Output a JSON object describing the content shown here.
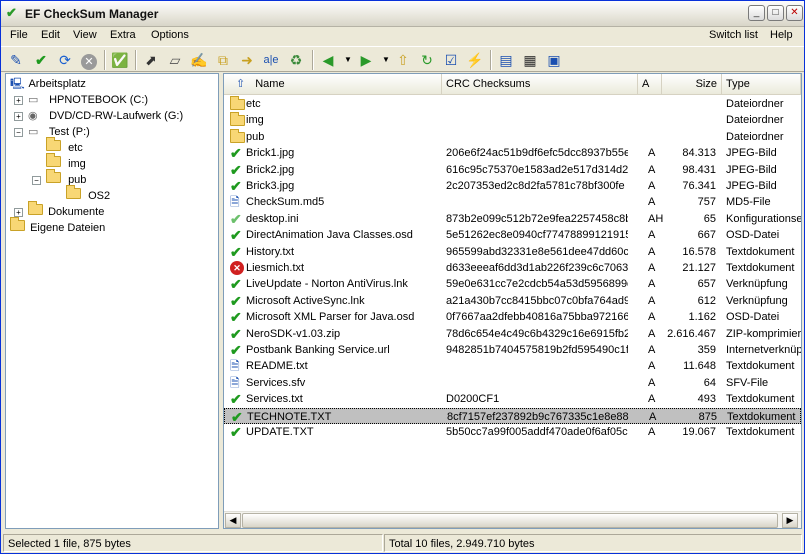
{
  "window": {
    "title": "EF CheckSum Manager",
    "min": "_",
    "max": "□",
    "close": "✕"
  },
  "menu": {
    "left": [
      "File",
      "Edit",
      "View",
      "Extra",
      "Options"
    ],
    "switch_list": "Switch list",
    "help": "Help"
  },
  "toolbar": {
    "icons": [
      "new-checksum-icon",
      "check-icon",
      "refresh-icon",
      "stop-icon",
      "verify-icon",
      "new-file-icon",
      "open-icon",
      "edit-icon",
      "copy-icon",
      "move-icon",
      "rename-icon",
      "properties-icon",
      "back-icon",
      "forward-icon",
      "up-folder-icon",
      "refresh-folder-icon",
      "check-list-icon",
      "flash-icon",
      "view-list-icon",
      "view-details-icon",
      "view-thumbs-icon"
    ]
  },
  "tree": {
    "root": "Arbeitsplatz",
    "items": [
      {
        "label": "HPNOTEBOOK (C:)",
        "type": "drive"
      },
      {
        "label": "DVD/CD-RW-Laufwerk (G:)",
        "type": "cdrom"
      },
      {
        "label": "Test (P:)",
        "type": "drive"
      },
      {
        "label": "etc",
        "type": "folder"
      },
      {
        "label": "img",
        "type": "folder"
      },
      {
        "label": "pub",
        "type": "folder"
      },
      {
        "label": "OS2",
        "type": "folder"
      },
      {
        "label": "Dokumente",
        "type": "folder"
      },
      {
        "label": "Eigene Dateien",
        "type": "docs"
      }
    ]
  },
  "list": {
    "headers": {
      "name": "Name",
      "crc": "CRC Checksums",
      "a": "A",
      "size": "Size",
      "type": "Type"
    },
    "rows": [
      {
        "status": "folder",
        "name": "etc",
        "crc": "",
        "a": "",
        "size": "",
        "type": "Dateiordner"
      },
      {
        "status": "folder",
        "name": "img",
        "crc": "",
        "a": "",
        "size": "",
        "type": "Dateiordner"
      },
      {
        "status": "folder",
        "name": "pub",
        "crc": "",
        "a": "",
        "size": "",
        "type": "Dateiordner"
      },
      {
        "status": "ok",
        "name": "Brick1.jpg",
        "crc": "206e6f24ac51b9df6efc5dcc8937b55e",
        "a": "A",
        "size": "84.313",
        "type": "JPEG-Bild"
      },
      {
        "status": "ok",
        "name": "Brick2.jpg",
        "crc": "616c95c75370e1583ad2e517d314d2b",
        "a": "A",
        "size": "98.431",
        "type": "JPEG-Bild"
      },
      {
        "status": "ok",
        "name": "Brick3.jpg",
        "crc": "2c207353ed2c8d2fa5781c78bf300fe",
        "a": "A",
        "size": "76.341",
        "type": "JPEG-Bild"
      },
      {
        "status": "doc",
        "name": "CheckSum.md5",
        "crc": "",
        "a": "A",
        "size": "757",
        "type": "MD5-File"
      },
      {
        "status": "okl",
        "name": "desktop.ini",
        "crc": "873b2e099c512b72e9fea2257458c8b8",
        "a": "AH",
        "size": "65",
        "type": "Konfigurationse"
      },
      {
        "status": "ok",
        "name": "DirectAnimation Java Classes.osd",
        "crc": "5e51262ec8e0940cf774788991219153",
        "a": "A",
        "size": "667",
        "type": "OSD-Datei"
      },
      {
        "status": "ok",
        "name": "History.txt",
        "crc": "965599abd32331e8e561dee47dd60c62",
        "a": "A",
        "size": "16.578",
        "type": "Textdokument"
      },
      {
        "status": "err",
        "name": "Liesmich.txt",
        "crc": "d633eeeaf6dd3d1ab226f239c6c7063",
        "a": "A",
        "size": "21.127",
        "type": "Textdokument"
      },
      {
        "status": "ok",
        "name": "LiveUpdate - Norton AntiVirus.lnk",
        "crc": "59e0e631cc7e2cdcb54a53d5956899c",
        "a": "A",
        "size": "657",
        "type": "Verknüpfung"
      },
      {
        "status": "ok",
        "name": "Microsoft ActiveSync.lnk",
        "crc": "a21a430b7cc8415bbc07c0bfa764ad9",
        "a": "A",
        "size": "612",
        "type": "Verknüpfung"
      },
      {
        "status": "ok",
        "name": "Microsoft XML Parser for Java.osd",
        "crc": "0f7667aa2dfebb40816a75bba972166d",
        "a": "A",
        "size": "1.162",
        "type": "OSD-Datei"
      },
      {
        "status": "ok",
        "name": "NeroSDK-v1.03.zip",
        "crc": "78d6c654e4c49c6b4329c16e6915fb29",
        "a": "A",
        "size": "2.616.467",
        "type": "ZIP-komprimiert"
      },
      {
        "status": "ok",
        "name": "Postbank Banking Service.url",
        "crc": "9482851b7404575819b2fd595490c1fc",
        "a": "A",
        "size": "359",
        "type": "Internetverknüp"
      },
      {
        "status": "doc",
        "name": "README.txt",
        "crc": "",
        "a": "A",
        "size": "11.648",
        "type": "Textdokument"
      },
      {
        "status": "doc",
        "name": "Services.sfv",
        "crc": "",
        "a": "A",
        "size": "64",
        "type": "SFV-File"
      },
      {
        "status": "ok",
        "name": "Services.txt",
        "crc": "D0200CF1",
        "a": "A",
        "size": "493",
        "type": "Textdokument"
      },
      {
        "status": "ok",
        "name": "TECHNOTE.TXT",
        "crc": "8cf7157ef237892b9c767335c1e8e88",
        "a": "A",
        "size": "875",
        "type": "Textdokument",
        "selected": true
      },
      {
        "status": "ok",
        "name": "UPDATE.TXT",
        "crc": "5b50cc7a99f005addf470ade0f6af05c",
        "a": "A",
        "size": "19.067",
        "type": "Textdokument"
      }
    ]
  },
  "status": {
    "left": "Selected 1 file, 875 bytes",
    "right": "Total 10 files, 2.949.710 bytes"
  }
}
